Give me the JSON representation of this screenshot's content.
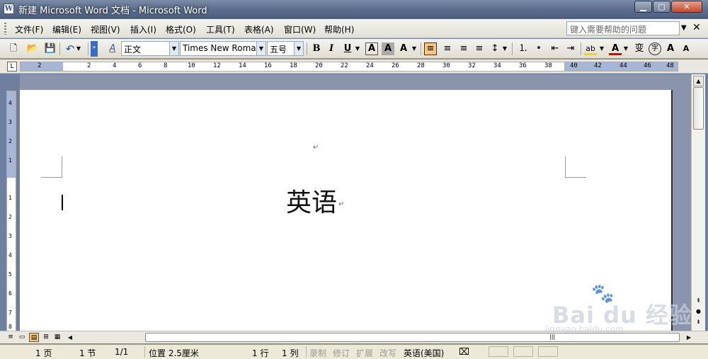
{
  "window": {
    "title": "新建 Microsoft Word 文档 - Microsoft Word",
    "app_icon": "W",
    "controls": {
      "minimize": "▁",
      "maximize": "▢",
      "close": "✕"
    }
  },
  "menubar": {
    "items": [
      "文件(F)",
      "编辑(E)",
      "视图(V)",
      "插入(I)",
      "格式(O)",
      "工具(T)",
      "表格(A)",
      "窗口(W)",
      "帮助(H)"
    ],
    "help_placeholder": "键入需要帮助的问题",
    "close_doc": "✕"
  },
  "toolbar": {
    "style": "正文",
    "font": "Times New Roman",
    "size": "五号",
    "buttons": {
      "new": "🗋",
      "open": "📂",
      "save": "💾",
      "undo": "↶",
      "styles_icon": "A",
      "bold": "B",
      "italic": "I",
      "underline": "U",
      "char_border": "A",
      "char_shading": "A",
      "effects": "A",
      "align_left": "≡",
      "center": "≡",
      "align_right": "≡",
      "justify": "≡",
      "line_spacing": "↕",
      "numbering": "⒈",
      "bullets": "•",
      "decrease_indent": "⇤",
      "increase_indent": "⇥",
      "highlight": "ab",
      "font_color": "A",
      "phonetic": "变",
      "enclose": "字",
      "grow": "A",
      "shrink": "A"
    }
  },
  "ruler": {
    "tab_selector": "L",
    "h_numbers": [
      "2",
      "2",
      "4",
      "6",
      "8",
      "10",
      "12",
      "14",
      "16",
      "18",
      "20",
      "22",
      "24",
      "26",
      "28",
      "30",
      "32",
      "34",
      "36",
      "38",
      "40",
      "42",
      "44",
      "46",
      "48"
    ],
    "v_numbers": [
      "4",
      "3",
      "2",
      "1",
      "1",
      "2",
      "3",
      "4",
      "5",
      "6",
      "7",
      "8"
    ]
  },
  "document": {
    "text": "英语",
    "para_mark": "↵"
  },
  "scrollbar": {
    "up": "▲",
    "down": "▼",
    "prev": "⇞",
    "select": "●",
    "next": "⇟"
  },
  "bottom": {
    "view_buttons": [
      "≡",
      "▭",
      "▤",
      "⊞",
      "▦"
    ],
    "scroll_grip": "|||"
  },
  "statusbar": {
    "page": "1 页",
    "section": "1 节",
    "page_of": "1/1",
    "position": "位置 2.5厘米",
    "line": "1 行",
    "column": "1 列",
    "rec": "录制",
    "trk": "修订",
    "ext": "扩展",
    "ovr": "改写",
    "language": "英语(美国)",
    "spell_icon": "⌧"
  },
  "watermark": {
    "brand": "Bai du 经验",
    "url": "jingyan.baidu.com",
    "paw": "🐾"
  }
}
